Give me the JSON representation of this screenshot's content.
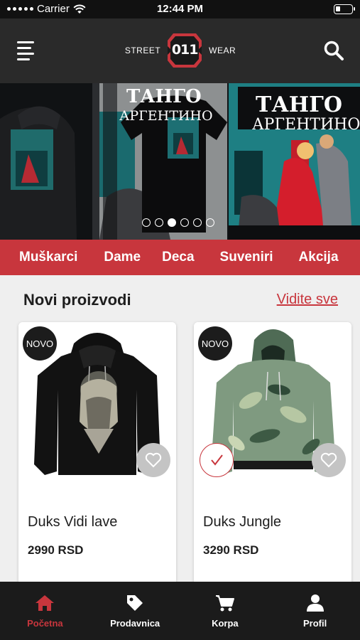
{
  "status_bar": {
    "carrier": "Carrier",
    "time": "12:44 PM",
    "battery_level": 0.25
  },
  "header": {
    "brand_left": "STREET",
    "brand_badge": "011",
    "brand_right": "WEAR",
    "menu_icon": "hamburger-menu-icon",
    "search_icon": "search-icon"
  },
  "hero": {
    "poster_title": "ТАНГО",
    "poster_subtitle": "АРГЕНТИНО",
    "slide_count": 6,
    "active_slide": 3
  },
  "categories": [
    "Muškarci",
    "Dame",
    "Deca",
    "Suveniri",
    "Akcija"
  ],
  "section": {
    "title": "Novi proizvodi",
    "see_all": "Vidite sve"
  },
  "products": [
    {
      "badge": "NOVO",
      "name": "Duks Vidi lave",
      "price": "2990 RSD",
      "favorite_icon": "heart-icon",
      "in_cart": false
    },
    {
      "badge": "NOVO",
      "name": "Duks Jungle",
      "price": "3290 RSD",
      "favorite_icon": "heart-icon",
      "in_cart": true
    }
  ],
  "tabs": [
    {
      "label": "Početna",
      "icon": "home-icon",
      "active": true
    },
    {
      "label": "Prodavnica",
      "icon": "tag-icon",
      "active": false
    },
    {
      "label": "Korpa",
      "icon": "cart-icon",
      "active": false
    },
    {
      "label": "Profil",
      "icon": "user-icon",
      "active": false
    }
  ],
  "colors": {
    "accent": "#c8363d",
    "header_bg": "#2a2a2a",
    "tabbar_bg": "#1b1b1b"
  }
}
